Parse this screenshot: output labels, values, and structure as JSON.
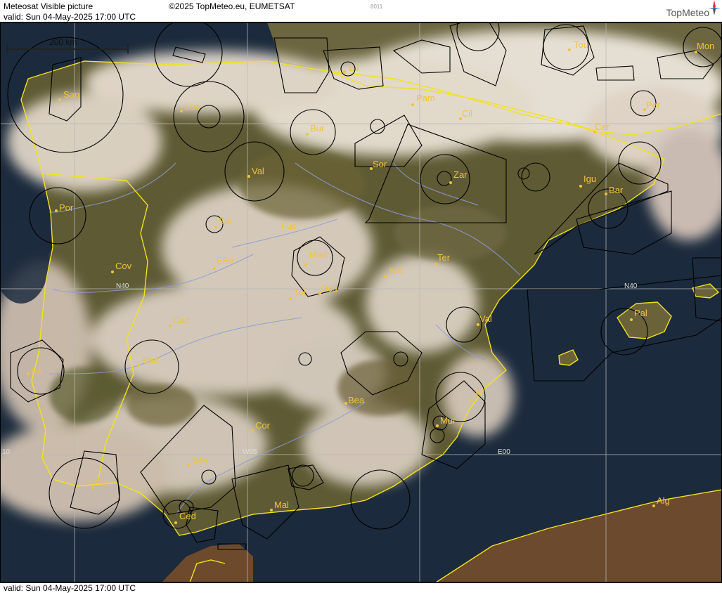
{
  "header": {
    "title": "Meteosat Visible picture",
    "copyright": "©2025 TopMeteo.eu, EUMETSAT",
    "image_id": "8011",
    "valid": "valid:  Sun  04-May-2025  17:00 UTC",
    "brand": "TopMeteo"
  },
  "footer": {
    "valid": "valid:  Sun  04-May-2025  17:00 UTC"
  },
  "scale": {
    "label": "200 km"
  },
  "grid_labels": {
    "n40_west": "N40",
    "n40_east": "N40",
    "w05": "W05",
    "e00": "E00",
    "w10": "10"
  },
  "cities": [
    {
      "id": "san",
      "label": "San"
    },
    {
      "id": "luc",
      "label": "Luc"
    },
    {
      "id": "bil",
      "label": "Bil"
    },
    {
      "id": "pam",
      "label": "Pam"
    },
    {
      "id": "cil",
      "label": "Cil"
    },
    {
      "id": "tou",
      "label": "Tou"
    },
    {
      "id": "mon",
      "label": "Mon"
    },
    {
      "id": "per",
      "label": "Per"
    },
    {
      "id": "cer",
      "label": "Cer"
    },
    {
      "id": "bur",
      "label": "Bur"
    },
    {
      "id": "val-n",
      "label": "Val"
    },
    {
      "id": "sor",
      "label": "Sor"
    },
    {
      "id": "zar",
      "label": "Zar"
    },
    {
      "id": "igu",
      "label": "Igu"
    },
    {
      "id": "bar",
      "label": "Bar"
    },
    {
      "id": "por",
      "label": "Por"
    },
    {
      "id": "sal",
      "label": "Sal"
    },
    {
      "id": "fue",
      "label": "Fue"
    },
    {
      "id": "mad",
      "label": "Mad"
    },
    {
      "id": "cov",
      "label": "Cov"
    },
    {
      "id": "eba",
      "label": "EBa"
    },
    {
      "id": "sot",
      "label": "Sot"
    },
    {
      "id": "ter",
      "label": "Ter"
    },
    {
      "id": "tol",
      "label": "Tol"
    },
    {
      "id": "oca",
      "label": "Oca"
    },
    {
      "id": "cac",
      "label": "Cac"
    },
    {
      "id": "val-e",
      "label": "Val"
    },
    {
      "id": "pal",
      "label": "Pal"
    },
    {
      "id": "lis",
      "label": "Lis"
    },
    {
      "id": "bad",
      "label": "Bad"
    },
    {
      "id": "ali",
      "label": "Ali"
    },
    {
      "id": "bea",
      "label": "Bea"
    },
    {
      "id": "mur",
      "label": "Mur"
    },
    {
      "id": "cor",
      "label": "Cor"
    },
    {
      "id": "sev",
      "label": "Sev"
    },
    {
      "id": "far",
      "label": "Far"
    },
    {
      "id": "mal",
      "label": "Mal"
    },
    {
      "id": "ced",
      "label": "Ced"
    },
    {
      "id": "alg",
      "label": "Alg"
    }
  ],
  "colors": {
    "sea": "#1b2a3c",
    "land": "#5d5a33",
    "cloud": "#e8ddcf",
    "city_label": "#f0c340",
    "coastline": "#f2e21c",
    "river": "#8f9bd8",
    "airspace": "#000000",
    "grid": "#b8b8b8"
  }
}
